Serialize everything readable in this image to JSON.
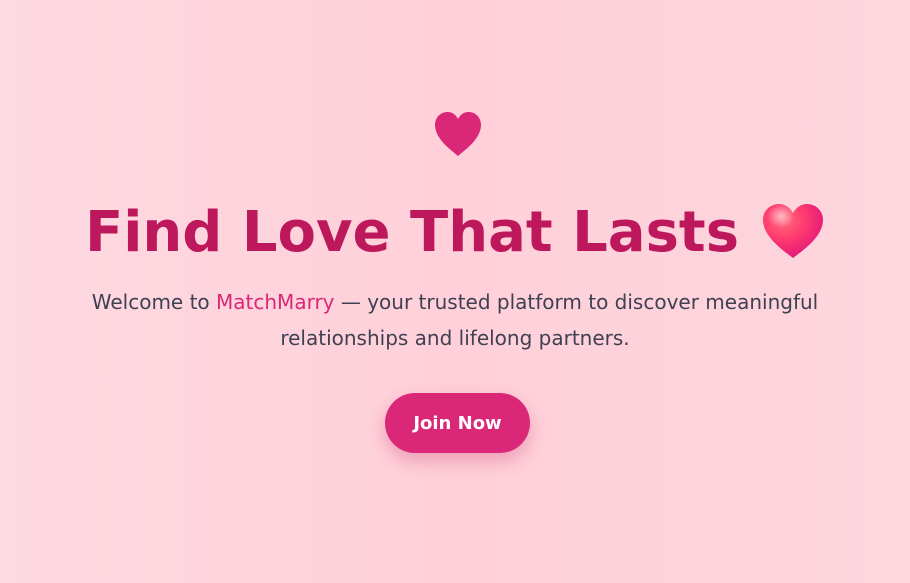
{
  "hero": {
    "top_icon": "heart-icon",
    "headline": "Find Love That Lasts",
    "headline_emoji": "heart-emoji-icon",
    "subtitle": {
      "prefix": "Welcome to ",
      "brand": "MatchMarry",
      "suffix": " — your trusted platform to discover meaningful relationships and lifelong partners."
    },
    "cta_label": "Join Now"
  },
  "colors": {
    "background": "#ffd0d9",
    "headline": "#be185d",
    "accent": "#db2777",
    "body_text": "#3f4152",
    "button_text": "#ffffff"
  }
}
